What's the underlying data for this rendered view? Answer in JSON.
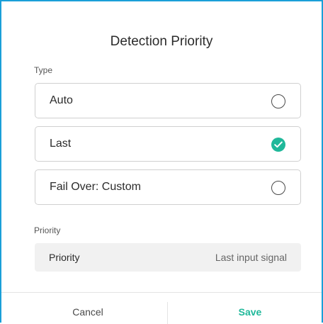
{
  "dialog": {
    "title": "Detection Priority"
  },
  "type_section": {
    "label": "Type",
    "options": [
      {
        "label": "Auto",
        "selected": false
      },
      {
        "label": "Last",
        "selected": true
      },
      {
        "label": "Fail Over: Custom",
        "selected": false
      }
    ]
  },
  "priority_section": {
    "label": "Priority",
    "row": {
      "name": "Priority",
      "value": "Last input signal"
    }
  },
  "footer": {
    "cancel_label": "Cancel",
    "save_label": "Save"
  },
  "colors": {
    "accent": "#1fb89a",
    "frame_border": "#1a9fd8"
  },
  "icons": {
    "selected": "check-circle-icon",
    "unselected": "radio-empty-icon"
  }
}
